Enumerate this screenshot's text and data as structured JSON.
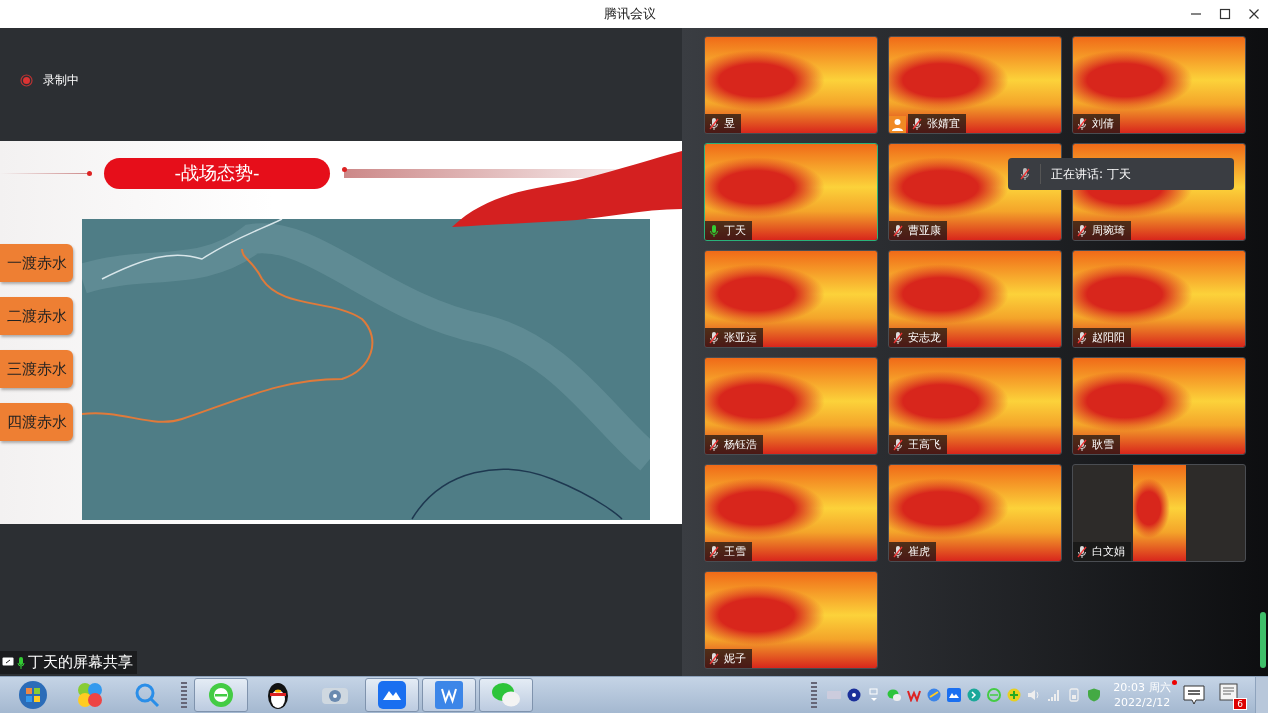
{
  "window": {
    "title": "腾讯会议"
  },
  "recording": {
    "label": "录制中",
    "on": true
  },
  "slide": {
    "title": "-战场态势-",
    "sections": [
      {
        "label": "一渡赤水"
      },
      {
        "label": "二渡赤水"
      },
      {
        "label": "三渡赤水"
      },
      {
        "label": "四渡赤水"
      }
    ]
  },
  "share_label": {
    "text": "丁天的屏幕共享"
  },
  "participants": [
    {
      "name": "昱",
      "muted": true,
      "speaking": false,
      "badge": false,
      "kind": "video"
    },
    {
      "name": "张婧宜",
      "muted": true,
      "speaking": false,
      "badge": true,
      "kind": "video"
    },
    {
      "name": "刘倩",
      "muted": true,
      "speaking": false,
      "badge": false,
      "kind": "video"
    },
    {
      "name": "丁天",
      "muted": false,
      "speaking": true,
      "badge": false,
      "kind": "video"
    },
    {
      "name": "曹亚康",
      "muted": true,
      "speaking": false,
      "badge": false,
      "kind": "video"
    },
    {
      "name": "周琬琦",
      "muted": true,
      "speaking": false,
      "badge": false,
      "kind": "video"
    },
    {
      "name": "张亚运",
      "muted": true,
      "speaking": false,
      "badge": false,
      "kind": "video"
    },
    {
      "name": "安志龙",
      "muted": true,
      "speaking": false,
      "badge": false,
      "kind": "video"
    },
    {
      "name": "赵阳阳",
      "muted": true,
      "speaking": false,
      "badge": false,
      "kind": "video"
    },
    {
      "name": "杨钰浩",
      "muted": true,
      "speaking": false,
      "badge": false,
      "kind": "video"
    },
    {
      "name": "王高飞",
      "muted": true,
      "speaking": false,
      "badge": false,
      "kind": "video"
    },
    {
      "name": "耿雪",
      "muted": true,
      "speaking": false,
      "badge": false,
      "kind": "video"
    },
    {
      "name": "王雪",
      "muted": true,
      "speaking": false,
      "badge": false,
      "kind": "video"
    },
    {
      "name": "崔虎",
      "muted": true,
      "speaking": false,
      "badge": false,
      "kind": "video"
    },
    {
      "name": "白文娟",
      "muted": true,
      "speaking": false,
      "badge": false,
      "kind": "portrait"
    },
    {
      "name": "妮子",
      "muted": true,
      "speaking": false,
      "badge": false,
      "kind": "video"
    }
  ],
  "speaking_toast": {
    "text": "正在讲话: 丁天"
  },
  "taskbar": {
    "apps": [
      {
        "kind": "start",
        "active": false
      },
      {
        "kind": "pinwheel",
        "active": false
      },
      {
        "kind": "search",
        "active": false
      },
      {
        "kind": "browser",
        "active": true
      },
      {
        "kind": "penguin",
        "active": false
      },
      {
        "kind": "media",
        "active": false
      },
      {
        "kind": "meeting",
        "active": true
      },
      {
        "kind": "wps",
        "active": true
      },
      {
        "kind": "chat",
        "active": true
      }
    ],
    "clock": {
      "time": "20:03",
      "day": "周六",
      "date": "2022/2/12"
    },
    "notifications": {
      "count": "6"
    }
  }
}
